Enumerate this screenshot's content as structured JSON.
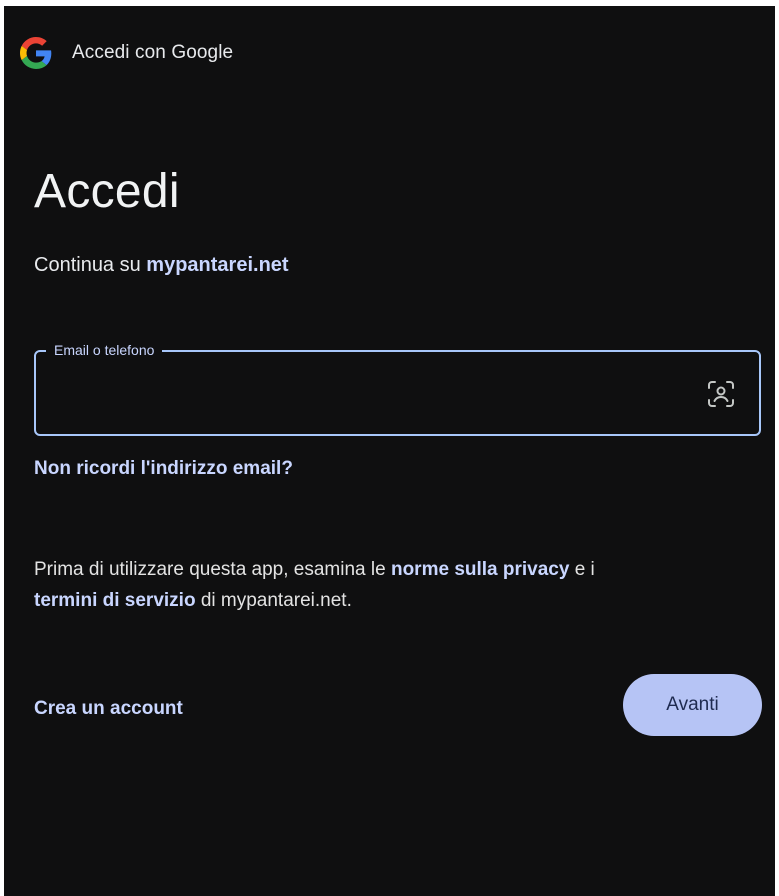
{
  "header": {
    "title": "Accedi con Google",
    "logo_icon": "google-g-logo"
  },
  "main": {
    "title": "Accedi",
    "subtitle_prefix": "Continua su ",
    "subtitle_domain": "mypantarei.net",
    "email_field": {
      "label": "Email o telefono",
      "value": "",
      "placeholder": "",
      "trailing_icon": "face-scan-icon"
    },
    "forgot_email_link": "Non ricordi l'indirizzo email?",
    "notice": {
      "part1": "Prima di utilizzare questa app, esamina le ",
      "privacy_link": "norme sulla privacy",
      "part2": " e i ",
      "terms_link": "termini di servizio",
      "part3": " di mypantarei.net."
    },
    "create_account_link": "Crea un account",
    "next_button": "Avanti"
  },
  "colors": {
    "background": "#0f0f10",
    "accent": "#c9d6ff",
    "field_border": "#a8c7fa",
    "button_bg": "#b6c4f5",
    "button_text": "#1f2b50"
  }
}
